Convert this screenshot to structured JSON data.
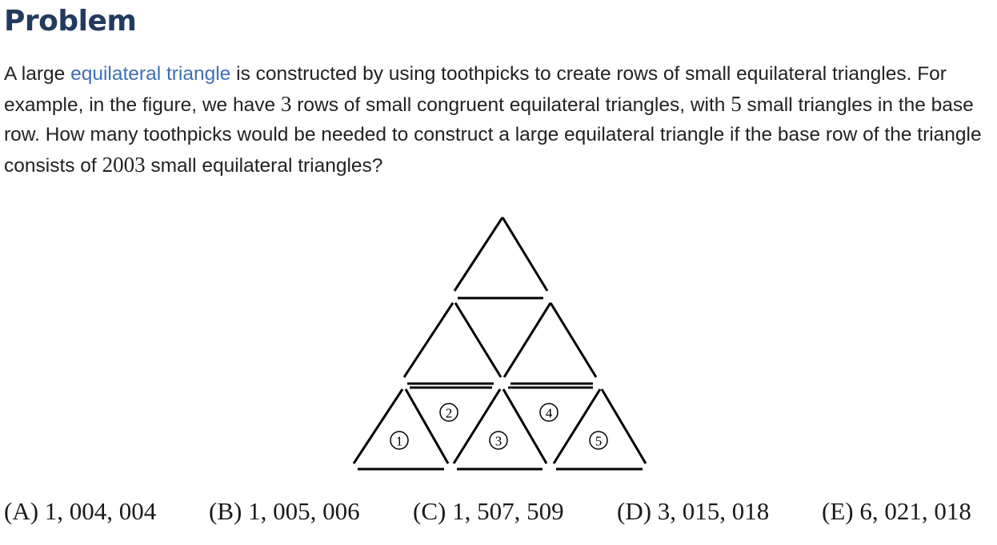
{
  "heading": "Problem",
  "problem": {
    "s1": "A large ",
    "link": "equilateral triangle",
    "s2": " is constructed by using toothpicks to create rows of small equilateral triangles. For example, in the figure, we have ",
    "m1": "3",
    "s3": " rows of small congruent equilateral triangles, with ",
    "m2": "5",
    "s4": " small triangles in the base row. How many toothpicks would be needed to construct a large equilateral triangle if the base row of the triangle consists of ",
    "m3": "2003",
    "s5": " small equilateral triangles?"
  },
  "figure": {
    "labels": [
      "1",
      "2",
      "3",
      "4",
      "5"
    ]
  },
  "choices": [
    {
      "letter": "(A)",
      "value": "1, 004, 004"
    },
    {
      "letter": "(B)",
      "value": "1, 005, 006"
    },
    {
      "letter": "(C)",
      "value": "1, 507, 509"
    },
    {
      "letter": "(D)",
      "value": "3, 015, 018"
    },
    {
      "letter": "(E)",
      "value": "6, 021, 018"
    }
  ]
}
